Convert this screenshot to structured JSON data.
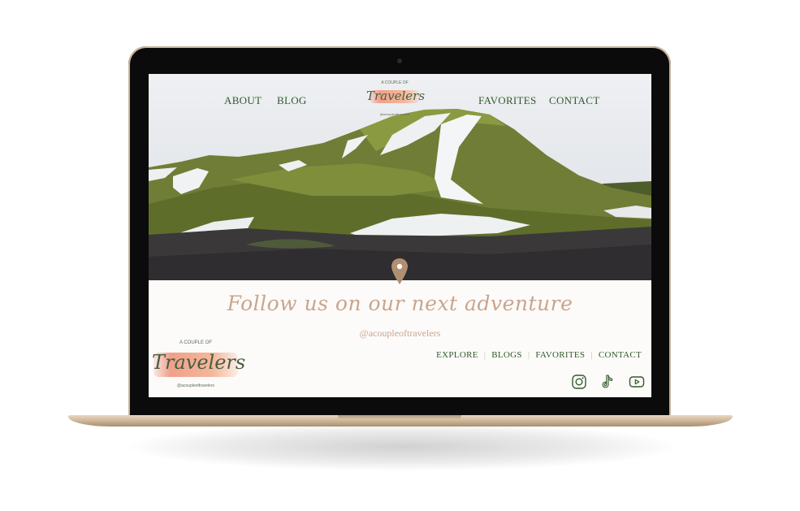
{
  "nav": {
    "left": [
      "ABOUT",
      "BLOG"
    ],
    "right": [
      "FAVORITES",
      "CONTACT"
    ]
  },
  "brand": {
    "prefix": "A COUPLE OF",
    "name": "Travelers",
    "handle": "@acoupleoftravelers"
  },
  "hero": {
    "pin_icon": "location-pin-icon"
  },
  "cta": {
    "headline": "Follow us on our next adventure",
    "handle": "@acoupleoftravelers"
  },
  "footer": {
    "nav": [
      "EXPLORE",
      "BLOGS",
      "FAVORITES",
      "CONTACT"
    ],
    "social": [
      "instagram-icon",
      "tiktok-icon",
      "youtube-icon"
    ]
  },
  "colors": {
    "nav_green": "#2f5a2a",
    "accent_tan": "#c9a58c",
    "brush_pink": "#f0a08a",
    "laptop_gold": "#c9b294"
  }
}
